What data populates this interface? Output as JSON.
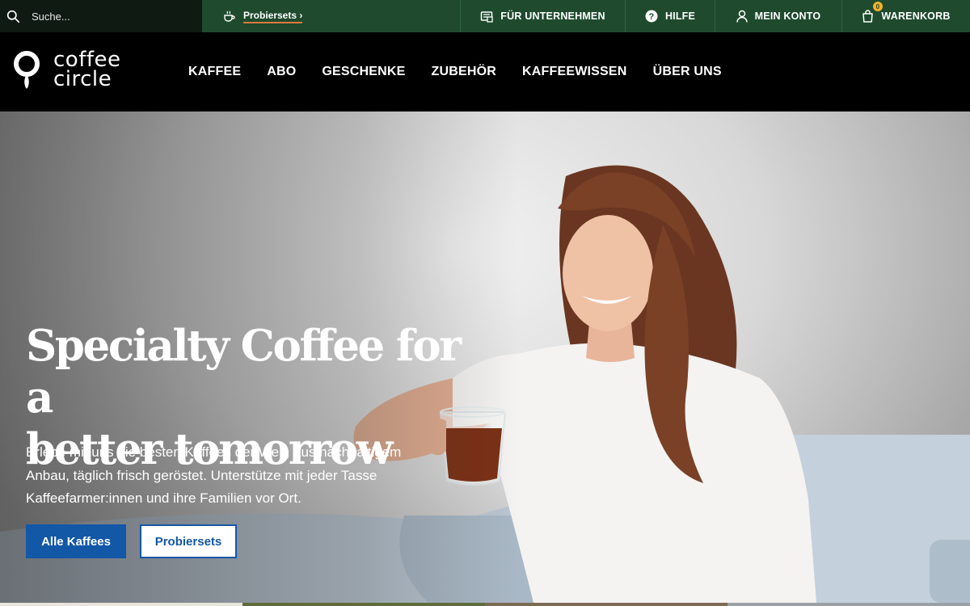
{
  "utility_bar": {
    "search": {
      "placeholder": "Suche..."
    },
    "probiersets_link": "Probiersets ›",
    "company_label": "FÜR UNTERNEHMEN",
    "help_label": "HILFE",
    "account_label": "MEIN KONTO",
    "cart_label": "WARENKORB",
    "cart_count": "0",
    "icons": [
      "search-icon",
      "coffee-cup-icon",
      "company-icon",
      "help-icon",
      "user-icon",
      "shopping-bag-icon"
    ]
  },
  "brand": {
    "logo_line1": "coffee",
    "logo_line2": "circle"
  },
  "nav": {
    "items": [
      "KAFFEE",
      "ABO",
      "GESCHENKE",
      "ZUBEHÖR",
      "KAFFEEWISSEN",
      "ÜBER UNS"
    ]
  },
  "hero": {
    "title_line1": "Specialty Coffee for a",
    "title_line2": "better tomorrow",
    "text_line1": "Erlebe mit uns die besten Kaffees der Welt, aus nachhaltigem",
    "text_line2": "Anbau, täglich frisch geröstet. Unterstütze mit jeder Tasse",
    "text_line3": "Kaffeefarmer:innen und ihre Familien vor Ort.",
    "primary_button": "Alle Kaffees",
    "secondary_button": "Probiersets"
  },
  "colors": {
    "utility_bg": "#1f4a2e",
    "search_bg": "#0e1a12",
    "nav_bg": "#000000",
    "accent_underline": "#e07a3c",
    "button_blue": "#1357a7",
    "badge_yellow": "#f2b12b"
  }
}
